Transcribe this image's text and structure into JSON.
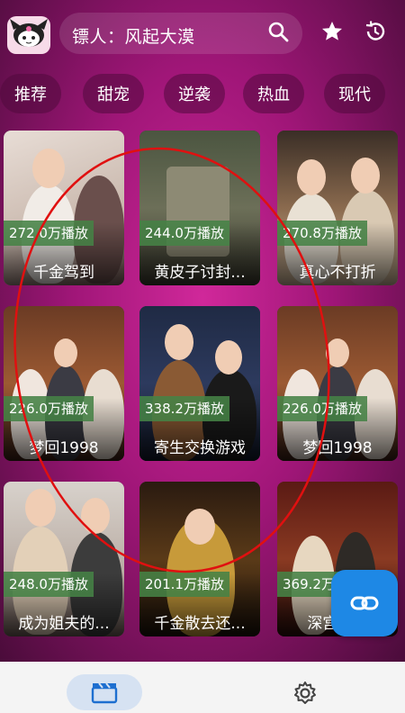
{
  "search": {
    "text": "镖人：风起大漠"
  },
  "categories": [
    {
      "label": "推荐"
    },
    {
      "label": "甜宠"
    },
    {
      "label": "逆袭"
    },
    {
      "label": "热血"
    },
    {
      "label": "现代"
    }
  ],
  "cards": [
    {
      "plays": "272.0万播放",
      "title": "千金驾到"
    },
    {
      "plays": "244.0万播放",
      "title": "黄皮子讨封..."
    },
    {
      "plays": "270.8万播放",
      "title": "真心不打折"
    },
    {
      "plays": "226.0万播放",
      "title": "梦回1998"
    },
    {
      "plays": "338.2万播放",
      "title": "寄生交换游戏"
    },
    {
      "plays": "226.0万播放",
      "title": "梦回1998"
    },
    {
      "plays": "248.0万播放",
      "title": "成为姐夫的..."
    },
    {
      "plays": "201.1万播放",
      "title": "千金散去还..."
    },
    {
      "plays": "369.2万播放",
      "title": "深宫风..."
    }
  ],
  "icons": {
    "logo": "kuromi-logo-icon",
    "search": "search-icon",
    "favorite": "star-icon",
    "history": "history-icon",
    "link": "link-icon",
    "home": "clapperboard-icon",
    "settings": "gear-icon"
  },
  "colors": {
    "accent": "#1e88e5",
    "plays_badge": "#468246",
    "background": "#a01678"
  }
}
